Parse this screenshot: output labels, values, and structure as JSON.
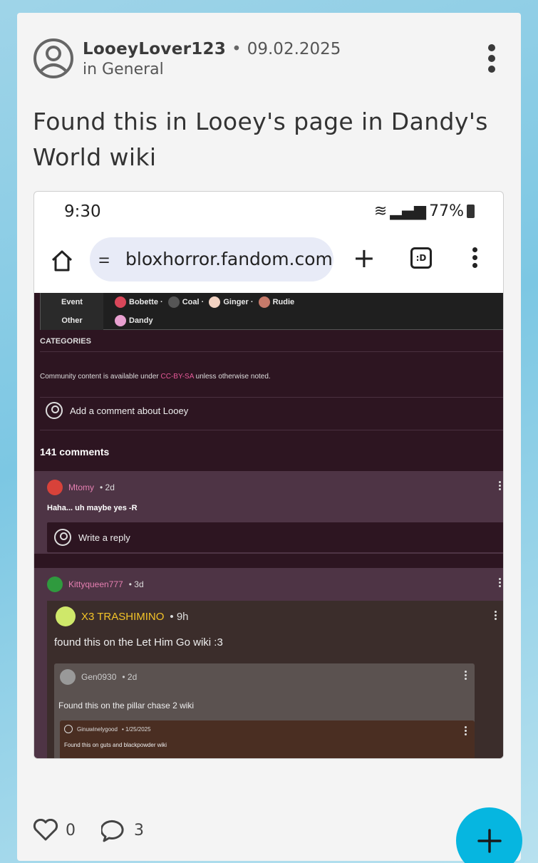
{
  "post": {
    "username": "LooeyLover123",
    "separator": "•",
    "date": "09.02.2025",
    "category": "in General",
    "title": "Found this in Looey's page in Dandy's World wiki",
    "likes": "0",
    "comments": "3"
  },
  "screenshot": {
    "status": {
      "time": "9:30",
      "battery": "77%"
    },
    "browser": {
      "url": "bloxhorror.fandom.com",
      "tabs_label": ":D"
    },
    "nav_rows": [
      {
        "key": "Event",
        "values": [
          "Bobette",
          "Coal",
          "Ginger",
          "Rudie"
        ]
      },
      {
        "key": "Other",
        "values": [
          "Dandy"
        ]
      }
    ],
    "categories_label": "CATEGORIES",
    "license": {
      "prefix": "Community content is available under ",
      "link": "CC-BY-SA",
      "suffix": " unless otherwise noted."
    },
    "add_comment": "Add a comment about Looey",
    "comment_count": "141 comments",
    "comment1": {
      "user": "Mtomy",
      "age": "• 2d",
      "text": "Haha... uh maybe yes -R",
      "reply": "Write a reply"
    },
    "comment2": {
      "user": "Kittyqueen777",
      "age": "• 3d",
      "nested_user": "X3 TRASHIMINO",
      "nested_age": "• 9h",
      "nested_text": "found this on the Let Him Go wiki :3",
      "inner_user": "Gen0930",
      "inner_age": "• 2d",
      "inner_text": "Found this on the pillar  chase 2 wiki",
      "inner2_user": "Ginuwinelygood",
      "inner2_age": "• 1/25/2025",
      "inner2_text": "Found this on guts and blackpowder wiki"
    }
  },
  "colors": {
    "fab": "#06b6e0",
    "card": "#f4f4f4",
    "wiki_bg": "#2d1521",
    "pink": "#e85a9a"
  }
}
